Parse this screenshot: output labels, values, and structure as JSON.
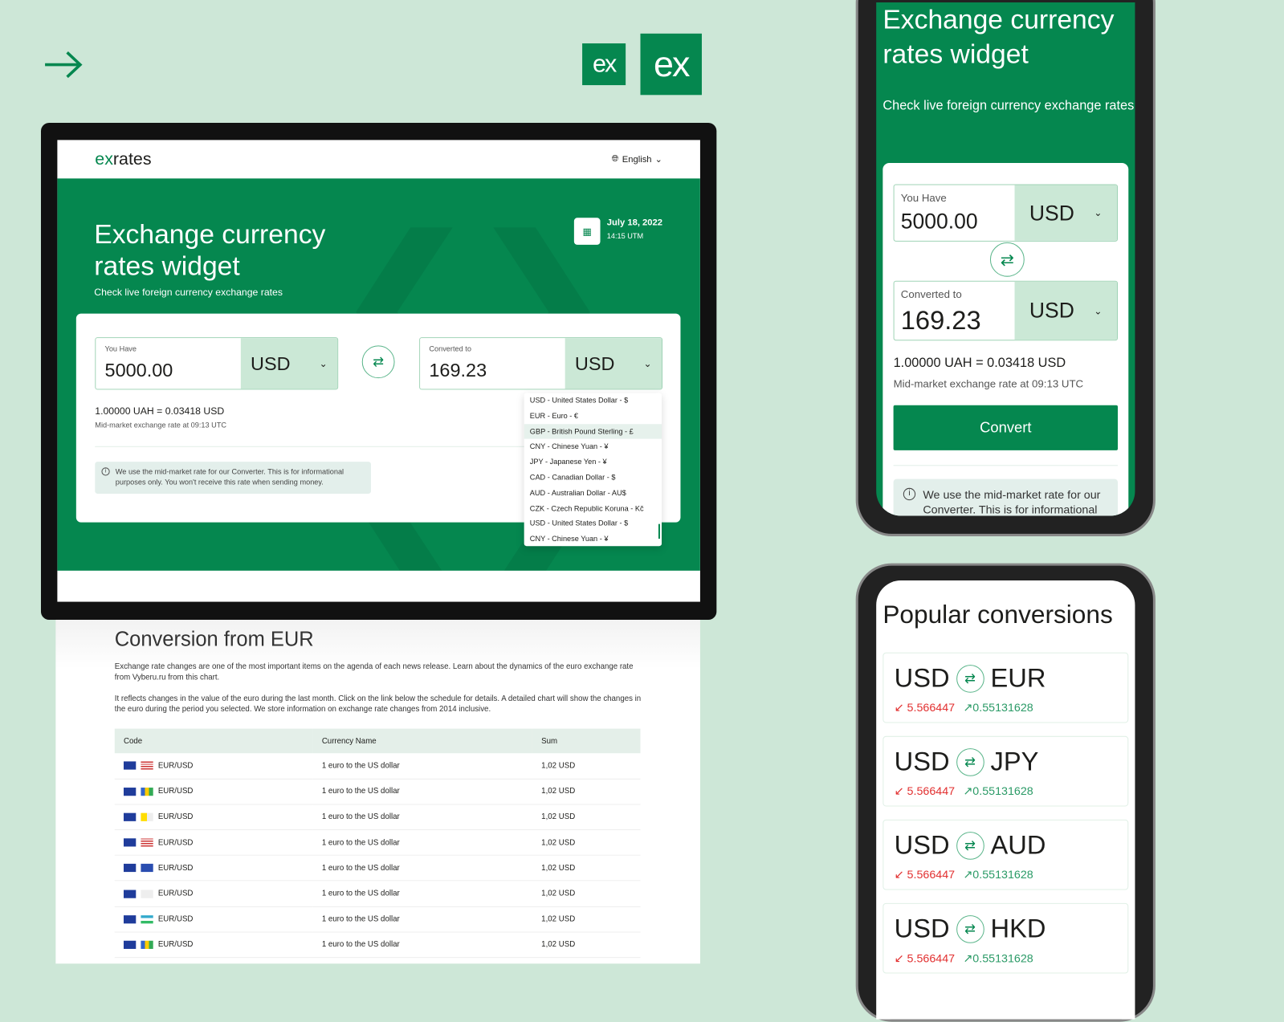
{
  "logo_small": "ex",
  "logo_large": "ex",
  "desktop": {
    "brand_prefix": "ex",
    "brand_suffix": "rates",
    "language": "English",
    "title": "Exchange currency rates widget",
    "subtitle": "Check live foreign currency exchange rates",
    "date": "July 18, 2022",
    "time": "14:15 UTM",
    "you_have_label": "You Have",
    "you_have_value": "5000.00",
    "from_currency": "USD",
    "converted_label": "Converted to",
    "converted_value": "169.23",
    "to_currency": "USD",
    "rate": "1.00000 UAH = 0.03418 USD",
    "rate_sub": "Mid-market exchange rate at 09:13 UTC",
    "note": "We use the mid-market rate for our Converter. This is for informational purposes only. You won't receive this rate when sending money.",
    "dropdown": [
      "USD - United States Dollar - $",
      "EUR - Euro - €",
      "GBP - British Pound Sterling - £",
      "CNY - Chinese Yuan - ¥",
      "JPY - Japanese Yen - ¥",
      "CAD - Canadian Dollar - $",
      "AUD - Australian Dollar - AU$",
      "CZK - Czech Republic Koruna - Kč",
      "USD - United States Dollar - $",
      "CNY - Chinese Yuan - ¥"
    ]
  },
  "doc": {
    "title": "Conversion from EUR",
    "p1": "Exchange rate changes are one of the most important items on the agenda of each news release. Learn about the dynamics of the euro exchange rate from Vyberu.ru from this chart.",
    "p2": "It reflects changes in the value of the euro during the last month. Click on the link below the schedule for details. A detailed chart will show the changes in the euro during the period you selected. We store information on exchange rate changes from 2014 inclusive.",
    "headers": [
      "Code",
      "Currency Name",
      "Sum"
    ],
    "rows": [
      [
        "EUR/USD",
        "1 euro to the US dollar",
        "1,02 USD"
      ],
      [
        "EUR/USD",
        "1 euro to the US dollar",
        "1,02 USD"
      ],
      [
        "EUR/USD",
        "1 euro to the US dollar",
        "1,02 USD"
      ],
      [
        "EUR/USD",
        "1 euro to the US dollar",
        "1,02 USD"
      ],
      [
        "EUR/USD",
        "1 euro to the US dollar",
        "1,02 USD"
      ],
      [
        "EUR/USD",
        "1 euro to the US dollar",
        "1,02 USD"
      ],
      [
        "EUR/USD",
        "1 euro to the US dollar",
        "1,02 USD"
      ],
      [
        "EUR/USD",
        "1 euro to the US dollar",
        "1,02 USD"
      ]
    ]
  },
  "mobile": {
    "title": "Exchange currency rates widget",
    "subtitle": "Check live foreign currency exchange rates",
    "you_have_label": "You Have",
    "you_have_value": "5000.00",
    "from_currency": "USD",
    "converted_label": "Converted to",
    "converted_value": "169.23",
    "to_currency": "USD",
    "rate": "1.00000 UAH = 0.03418 USD",
    "rate_sub": "Mid-market exchange rate at 09:13 UTC",
    "convert": "Convert",
    "note": "We use the mid-market rate for our Converter. This is for informational"
  },
  "popular": {
    "title": "Popular conversions",
    "items": [
      {
        "from": "USD",
        "to": "EUR",
        "down": "5.566447",
        "up": "0.55131628"
      },
      {
        "from": "USD",
        "to": "JPY",
        "down": "5.566447",
        "up": "0.55131628"
      },
      {
        "from": "USD",
        "to": "AUD",
        "down": "5.566447",
        "up": "0.55131628"
      },
      {
        "from": "USD",
        "to": "HKD",
        "down": "5.566447",
        "up": "0.55131628"
      }
    ]
  }
}
